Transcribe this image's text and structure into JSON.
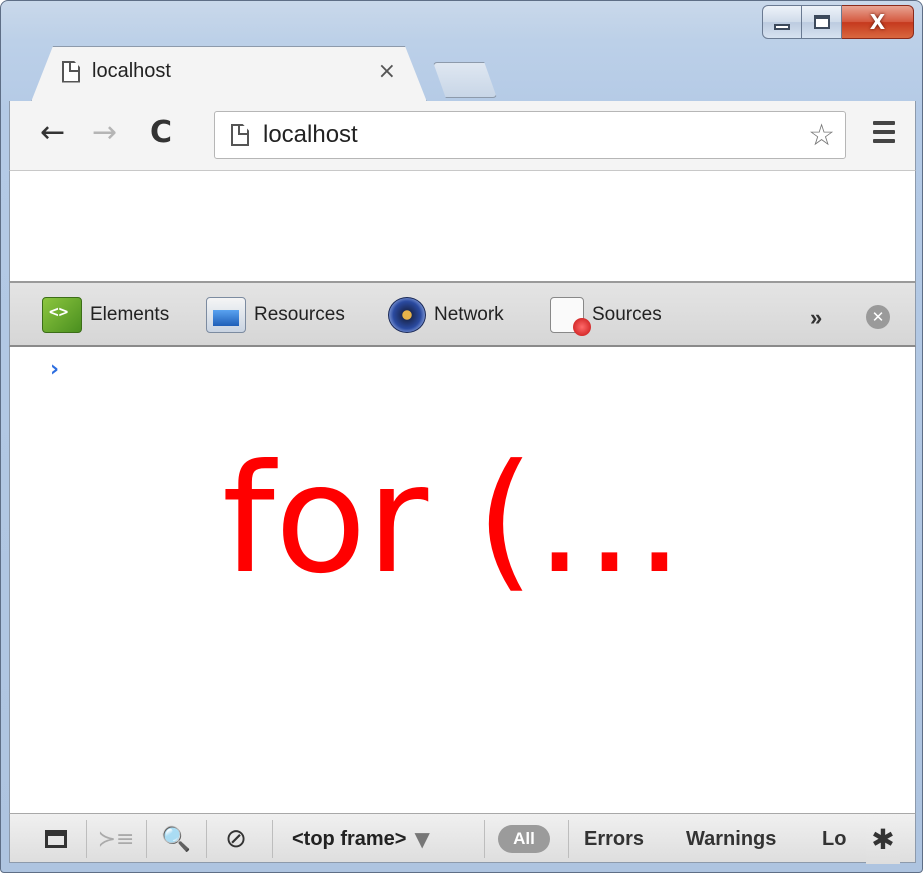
{
  "window": {
    "minimize_icon": "minimize-icon",
    "maximize_icon": "maximize-icon",
    "close_glyph": "X"
  },
  "tab": {
    "title": "localhost",
    "close_glyph": "×"
  },
  "toolbar": {
    "back_glyph": "←",
    "forward_glyph": "→",
    "reload_glyph": "C",
    "url": "localhost",
    "star_glyph": "☆"
  },
  "devtools": {
    "tabs": [
      {
        "label": "Elements",
        "icon": "elements-icon"
      },
      {
        "label": "Resources",
        "icon": "resources-icon"
      },
      {
        "label": "Network",
        "icon": "network-icon"
      },
      {
        "label": "Sources",
        "icon": "sources-icon"
      }
    ],
    "more_label": "»",
    "close_glyph": "✕"
  },
  "console": {
    "prompt": "›",
    "overlay_text": "for (…",
    "overlay_color": "#ff0000"
  },
  "statusbar": {
    "drawer_glyph": "≻≡",
    "search_glyph": "🔍",
    "clear_glyph": "⊘",
    "frame_label": "<top frame>",
    "frame_caret": "▼",
    "all_label": "All",
    "errors_label": "Errors",
    "warnings_label": "Warnings",
    "logs_label": "Lo",
    "gear_glyph": "✱"
  }
}
